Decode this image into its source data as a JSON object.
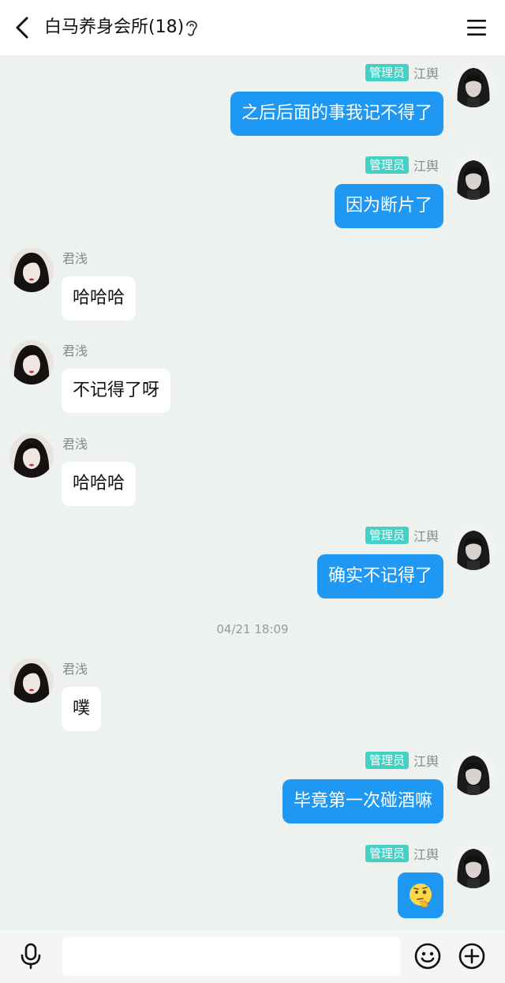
{
  "header": {
    "title": "白马养身会所(18)"
  },
  "admin_badge": "管理员",
  "messages": [
    {
      "side": "right",
      "sender": "江舆",
      "badge": true,
      "text": "之后后面的事我记不得了"
    },
    {
      "side": "right",
      "sender": "江舆",
      "badge": true,
      "text": "因为断片了"
    },
    {
      "side": "left",
      "sender": "君浅",
      "badge": false,
      "text": "哈哈哈"
    },
    {
      "side": "left",
      "sender": "君浅",
      "badge": false,
      "text": "不记得了呀"
    },
    {
      "side": "left",
      "sender": "君浅",
      "badge": false,
      "text": "哈哈哈"
    },
    {
      "side": "right",
      "sender": "江舆",
      "badge": true,
      "text": "确实不记得了"
    },
    {
      "side": "left",
      "sender": "君浅",
      "badge": false,
      "text": "噗"
    },
    {
      "side": "right",
      "sender": "江舆",
      "badge": true,
      "text": "毕竟第一次碰酒嘛"
    },
    {
      "side": "right",
      "sender": "江舆",
      "badge": true,
      "emoji": "thinking-face-emoji"
    }
  ],
  "timestamp": "04/21 18:09",
  "input": {
    "value": "",
    "placeholder": ""
  },
  "icons": {
    "back": "chevron-left-icon",
    "listen": "ear-icon",
    "menu": "menu-icon",
    "mic": "microphone-icon",
    "emoji": "smiley-icon",
    "more": "plus-circle-icon"
  },
  "colors": {
    "self_bubble": "#1e98f2",
    "other_bubble": "#ffffff",
    "admin_badge": "#44d0c4",
    "chat_background": "#eef2ee"
  }
}
